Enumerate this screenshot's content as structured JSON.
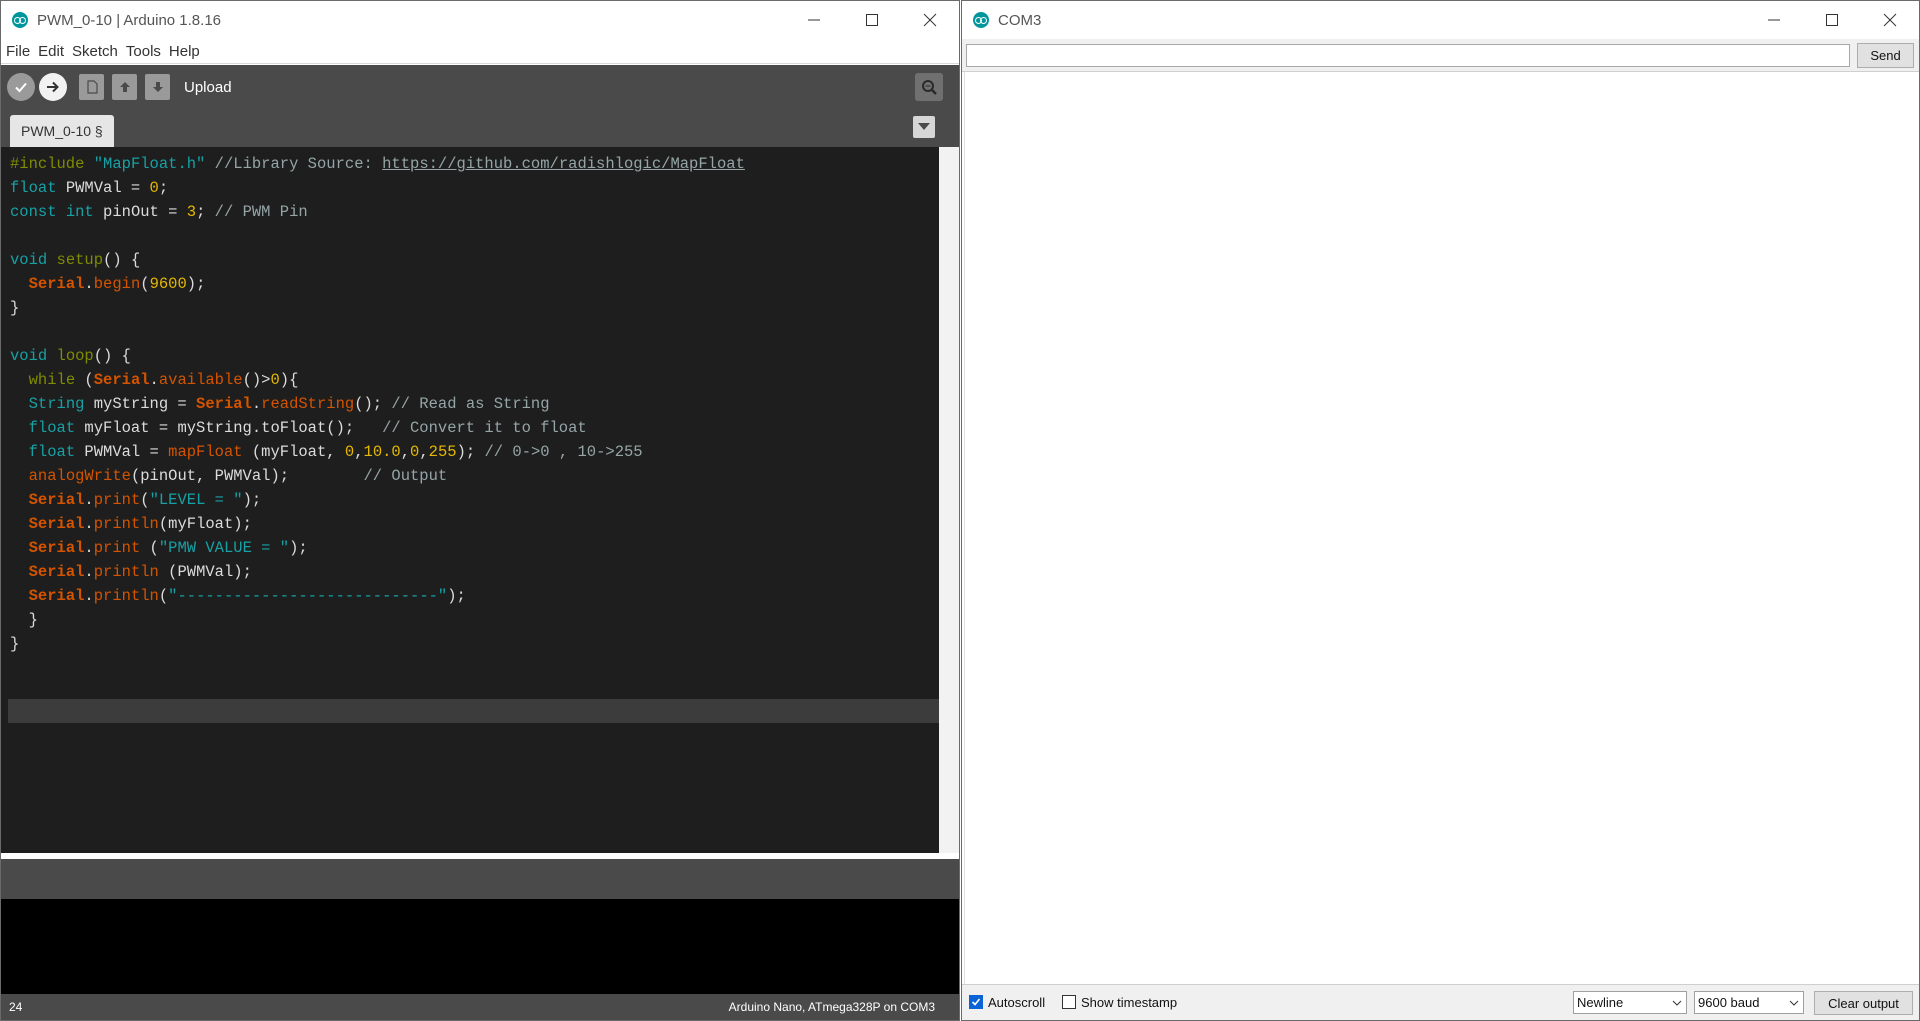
{
  "ide": {
    "title": "PWM_0-10 | Arduino 1.8.16",
    "menu": [
      "File",
      "Edit",
      "Sketch",
      "Tools",
      "Help"
    ],
    "toolbar": {
      "hover_label": "Upload",
      "icons": [
        "verify-icon",
        "upload-icon",
        "new-icon",
        "open-icon",
        "save-icon",
        "serial-monitor-icon"
      ]
    },
    "tab_label": "PWM_0-10 §",
    "code_lines": [
      "#include \"MapFloat.h\" //Library Source: https://github.com/radishlogic/MapFloat",
      "float PWMVal = 0;",
      "const int pinOut = 3; // PWM Pin",
      "",
      "void setup() {",
      "  Serial.begin(9600);",
      "}",
      "",
      "void loop() {",
      "  while (Serial.available()>0){",
      "  String myString = Serial.readString(); // Read as String",
      "  float myFloat = myString.toFloat();   // Convert it to float",
      "  float PWMVal = mapFloat (myFloat, 0,10.0,0,255); // 0->0 , 10->255",
      "  analogWrite(pinOut, PWMVal);        // Output",
      "  Serial.print(\"LEVEL = \");",
      "  Serial.println(myFloat);",
      "  Serial.print (\"PMW VALUE = \");",
      "  Serial.println (PWMVal);",
      "  Serial.println(\"----------------------------\");",
      "  }",
      "}",
      "",
      "",
      ""
    ],
    "current_line": "24",
    "board_info": "Arduino Nano, ATmega328P on COM3"
  },
  "serial": {
    "title": "COM3",
    "input_value": "",
    "send_label": "Send",
    "autoscroll_label": "Autoscroll",
    "autoscroll_checked": true,
    "timestamp_label": "Show timestamp",
    "timestamp_checked": false,
    "line_ending": "Newline",
    "baud": "9600 baud",
    "clear_label": "Clear output"
  },
  "colors": {
    "editor_bg": "#1e1e1e",
    "toolbar_bg": "#4a4a4a",
    "keyword_teal": "#17a1a5",
    "keyword_green": "#7f8b00",
    "keyword_orange": "#d35400",
    "number_yellow": "#e6b800",
    "comment_gray": "#95a5a6"
  }
}
